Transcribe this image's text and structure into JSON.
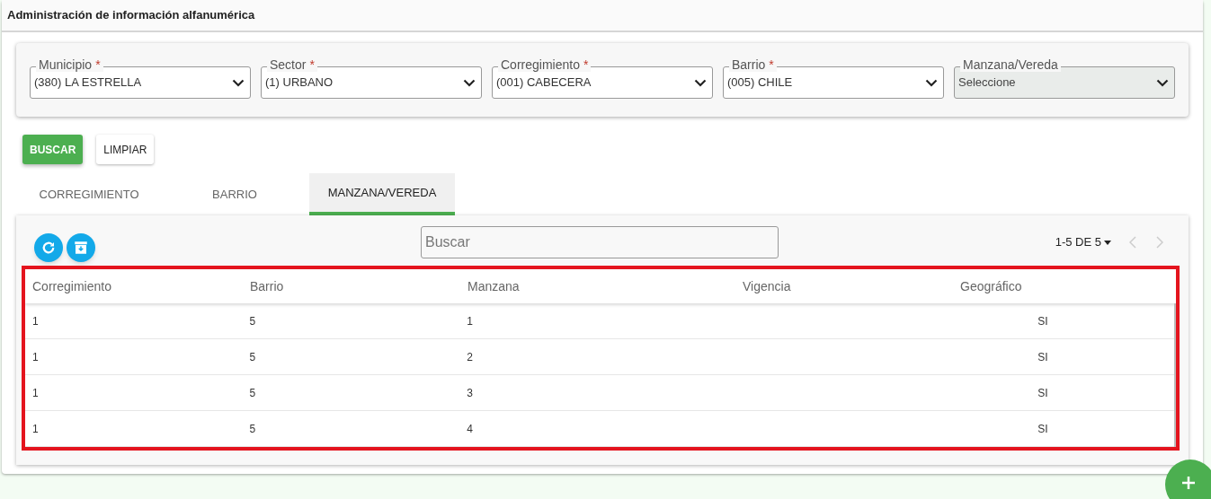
{
  "page_title": "Administración de información alfanumérica",
  "required_mark": "*",
  "filters": [
    {
      "label": "Municipio",
      "required": true,
      "value": "(380) LA ESTRELLA",
      "disabled": false
    },
    {
      "label": "Sector",
      "required": true,
      "value": "(1) URBANO",
      "disabled": false
    },
    {
      "label": "Corregimiento",
      "required": true,
      "value": "(001) CABECERA",
      "disabled": false
    },
    {
      "label": "Barrio",
      "required": true,
      "value": "(005) CHILE",
      "disabled": false
    },
    {
      "label": "Manzana/Vereda",
      "required": false,
      "value": "Seleccione",
      "disabled": true
    }
  ],
  "buttons": [
    {
      "label": "BUSCAR",
      "kind": "primary"
    },
    {
      "label": "LIMPIAR",
      "kind": "secondary"
    }
  ],
  "tabs": [
    {
      "label": "CORREGIMIENTO",
      "selected": false
    },
    {
      "label": "BARRIO",
      "selected": false
    },
    {
      "label": "MANZANA/VEREDA",
      "selected": true
    }
  ],
  "table": {
    "search": {
      "placeholder": "Buscar"
    },
    "pagination": "1-5 DE 5",
    "prev_disabled": true,
    "next_disabled": true,
    "highlighted": true,
    "columns": [
      "Corregimiento",
      "Barrio",
      "Manzana",
      "Vigencia",
      "Geográfico"
    ],
    "rows": [
      [
        "1",
        "5",
        "1",
        "",
        "SI"
      ],
      [
        "1",
        "5",
        "2",
        "",
        "SI"
      ],
      [
        "1",
        "5",
        "3",
        "",
        "SI"
      ],
      [
        "1",
        "5",
        "4",
        "",
        "SI"
      ]
    ]
  }
}
